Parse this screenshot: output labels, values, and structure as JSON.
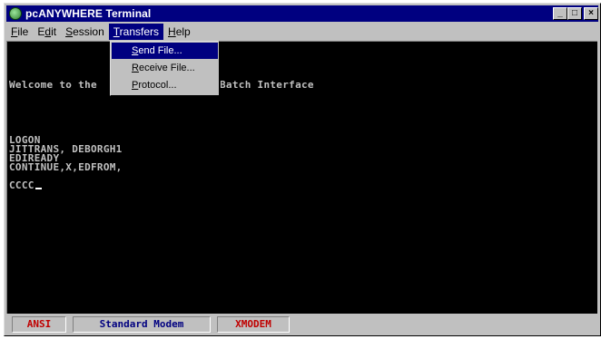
{
  "window": {
    "title": "pcANYWHERE Terminal",
    "icon": "pcanywhere-app-icon"
  },
  "controls": {
    "minimize": "_",
    "maximize": "□",
    "close": "×"
  },
  "menubar": {
    "file": {
      "u": "F",
      "rest": "ile"
    },
    "edit": {
      "pre": "E",
      "u": "d",
      "rest": "it"
    },
    "session": {
      "u": "S",
      "rest": "ession"
    },
    "transfers": {
      "u": "T",
      "rest": "ransfers"
    },
    "help": {
      "u": "H",
      "rest": "elp"
    }
  },
  "dropdown": {
    "send": {
      "u": "S",
      "rest": "end File..."
    },
    "receive": {
      "u": "R",
      "rest": "eceive File..."
    },
    "protocol": {
      "u": "P",
      "rest": "rotocol..."
    }
  },
  "terminal": {
    "welcome_left": "Welcome to the",
    "welcome_right": "Batch Interface",
    "lines": [
      "LOGON",
      "JITTRANS, DEBORGH1",
      "EDIREADY",
      "CONTINUE,X,EDFROM,",
      "",
      "CCCC"
    ]
  },
  "status": {
    "emulation": "ANSI",
    "connection": "Standard Modem",
    "protocol": "XMODEM"
  }
}
